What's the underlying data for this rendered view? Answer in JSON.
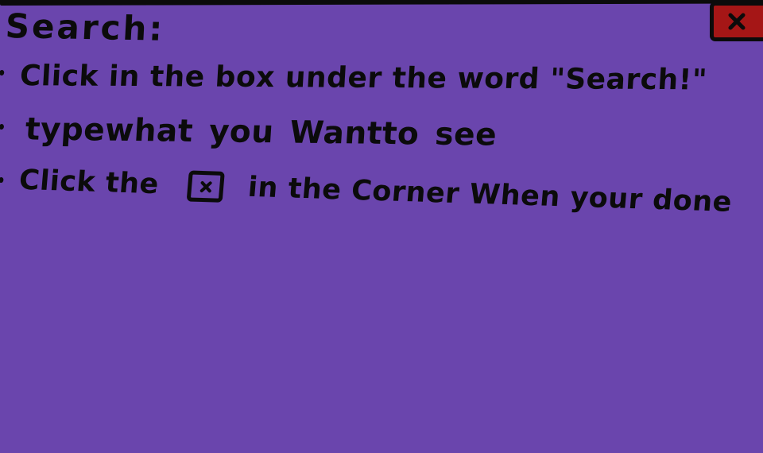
{
  "window": {
    "title": "Search:",
    "close_button": {
      "icon": "close-icon",
      "label": "×",
      "color": "#a51616"
    },
    "background_color": "#6a45ad"
  },
  "instructions": [
    {
      "text": "Click in the box under the word \"Search!\""
    },
    {
      "text": "typewhat you Wantto see"
    },
    {
      "before": "Click the",
      "icon": "x-box-icon",
      "after": "in the Corner When your done"
    }
  ]
}
